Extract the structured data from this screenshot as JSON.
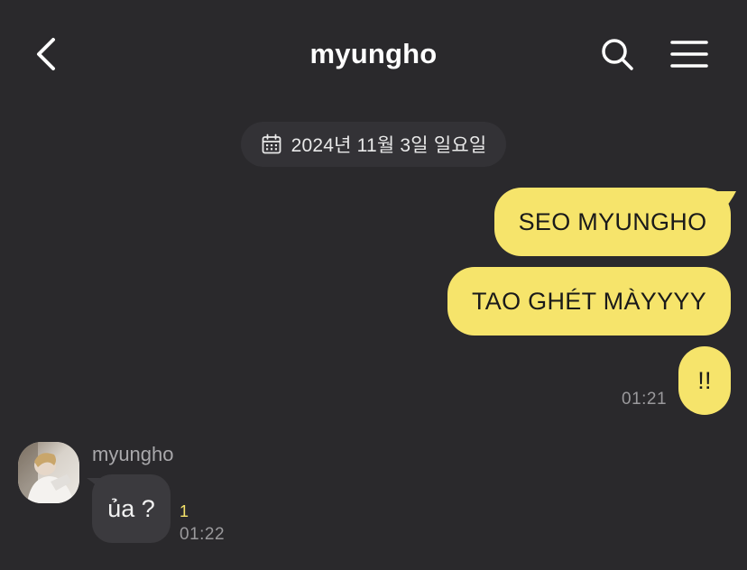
{
  "header": {
    "title": "myungho",
    "back_icon": "chevron-left-icon",
    "search_icon": "search-icon",
    "menu_icon": "hamburger-menu-icon"
  },
  "date_divider": {
    "icon": "calendar-icon",
    "text": "2024년 11월 3일 일요일"
  },
  "sent_messages": [
    {
      "text": "SEO MYUNGHO"
    },
    {
      "text": "TAO GHÉT MÀYYYY"
    },
    {
      "text": "!!"
    }
  ],
  "sent_time": "01:21",
  "received": {
    "sender": "myungho",
    "avatar": "profile-photo",
    "message": "ủa ?",
    "unread_count": "1",
    "time": "01:22"
  },
  "colors": {
    "background": "#2a292c",
    "sent_bubble": "#f6e46b",
    "received_bubble": "#3b3a3e",
    "date_chip": "#333236",
    "unread_accent": "#f6e46b"
  }
}
